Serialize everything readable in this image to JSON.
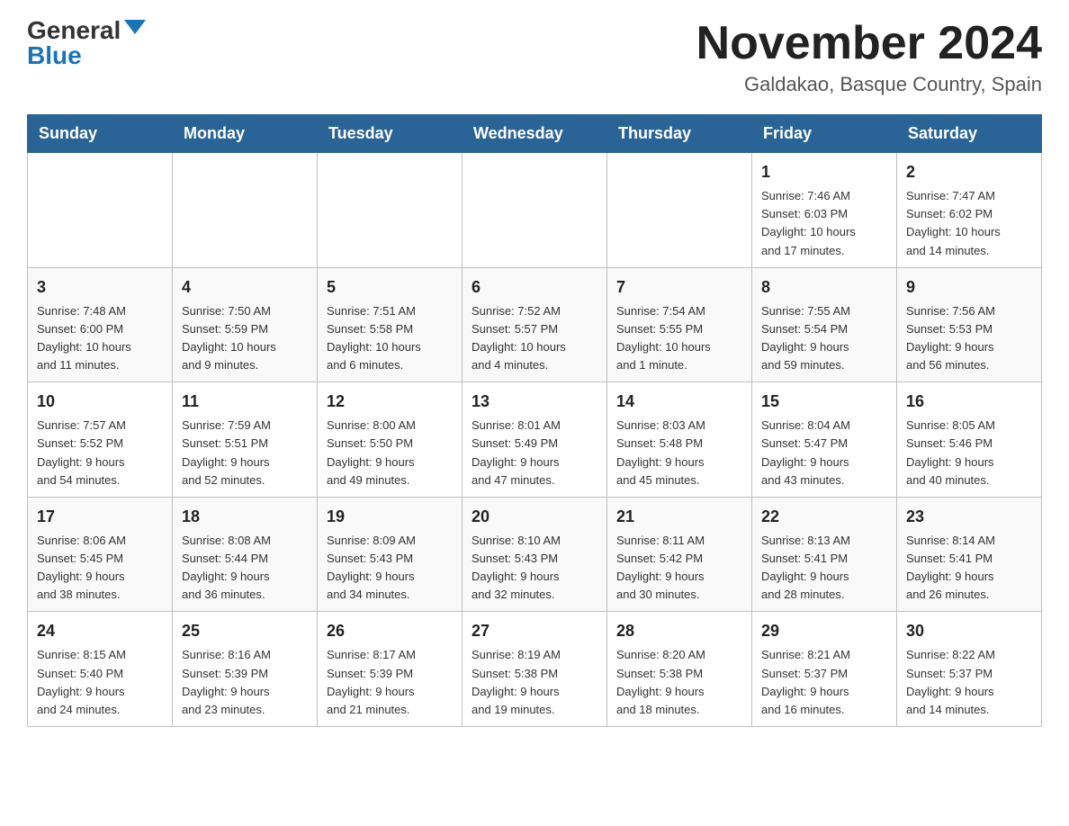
{
  "header": {
    "logo_general": "General",
    "logo_blue": "Blue",
    "month_title": "November 2024",
    "location": "Galdakao, Basque Country, Spain"
  },
  "weekdays": [
    "Sunday",
    "Monday",
    "Tuesday",
    "Wednesday",
    "Thursday",
    "Friday",
    "Saturday"
  ],
  "rows": [
    [
      {
        "day": "",
        "info": ""
      },
      {
        "day": "",
        "info": ""
      },
      {
        "day": "",
        "info": ""
      },
      {
        "day": "",
        "info": ""
      },
      {
        "day": "",
        "info": ""
      },
      {
        "day": "1",
        "info": "Sunrise: 7:46 AM\nSunset: 6:03 PM\nDaylight: 10 hours\nand 17 minutes."
      },
      {
        "day": "2",
        "info": "Sunrise: 7:47 AM\nSunset: 6:02 PM\nDaylight: 10 hours\nand 14 minutes."
      }
    ],
    [
      {
        "day": "3",
        "info": "Sunrise: 7:48 AM\nSunset: 6:00 PM\nDaylight: 10 hours\nand 11 minutes."
      },
      {
        "day": "4",
        "info": "Sunrise: 7:50 AM\nSunset: 5:59 PM\nDaylight: 10 hours\nand 9 minutes."
      },
      {
        "day": "5",
        "info": "Sunrise: 7:51 AM\nSunset: 5:58 PM\nDaylight: 10 hours\nand 6 minutes."
      },
      {
        "day": "6",
        "info": "Sunrise: 7:52 AM\nSunset: 5:57 PM\nDaylight: 10 hours\nand 4 minutes."
      },
      {
        "day": "7",
        "info": "Sunrise: 7:54 AM\nSunset: 5:55 PM\nDaylight: 10 hours\nand 1 minute."
      },
      {
        "day": "8",
        "info": "Sunrise: 7:55 AM\nSunset: 5:54 PM\nDaylight: 9 hours\nand 59 minutes."
      },
      {
        "day": "9",
        "info": "Sunrise: 7:56 AM\nSunset: 5:53 PM\nDaylight: 9 hours\nand 56 minutes."
      }
    ],
    [
      {
        "day": "10",
        "info": "Sunrise: 7:57 AM\nSunset: 5:52 PM\nDaylight: 9 hours\nand 54 minutes."
      },
      {
        "day": "11",
        "info": "Sunrise: 7:59 AM\nSunset: 5:51 PM\nDaylight: 9 hours\nand 52 minutes."
      },
      {
        "day": "12",
        "info": "Sunrise: 8:00 AM\nSunset: 5:50 PM\nDaylight: 9 hours\nand 49 minutes."
      },
      {
        "day": "13",
        "info": "Sunrise: 8:01 AM\nSunset: 5:49 PM\nDaylight: 9 hours\nand 47 minutes."
      },
      {
        "day": "14",
        "info": "Sunrise: 8:03 AM\nSunset: 5:48 PM\nDaylight: 9 hours\nand 45 minutes."
      },
      {
        "day": "15",
        "info": "Sunrise: 8:04 AM\nSunset: 5:47 PM\nDaylight: 9 hours\nand 43 minutes."
      },
      {
        "day": "16",
        "info": "Sunrise: 8:05 AM\nSunset: 5:46 PM\nDaylight: 9 hours\nand 40 minutes."
      }
    ],
    [
      {
        "day": "17",
        "info": "Sunrise: 8:06 AM\nSunset: 5:45 PM\nDaylight: 9 hours\nand 38 minutes."
      },
      {
        "day": "18",
        "info": "Sunrise: 8:08 AM\nSunset: 5:44 PM\nDaylight: 9 hours\nand 36 minutes."
      },
      {
        "day": "19",
        "info": "Sunrise: 8:09 AM\nSunset: 5:43 PM\nDaylight: 9 hours\nand 34 minutes."
      },
      {
        "day": "20",
        "info": "Sunrise: 8:10 AM\nSunset: 5:43 PM\nDaylight: 9 hours\nand 32 minutes."
      },
      {
        "day": "21",
        "info": "Sunrise: 8:11 AM\nSunset: 5:42 PM\nDaylight: 9 hours\nand 30 minutes."
      },
      {
        "day": "22",
        "info": "Sunrise: 8:13 AM\nSunset: 5:41 PM\nDaylight: 9 hours\nand 28 minutes."
      },
      {
        "day": "23",
        "info": "Sunrise: 8:14 AM\nSunset: 5:41 PM\nDaylight: 9 hours\nand 26 minutes."
      }
    ],
    [
      {
        "day": "24",
        "info": "Sunrise: 8:15 AM\nSunset: 5:40 PM\nDaylight: 9 hours\nand 24 minutes."
      },
      {
        "day": "25",
        "info": "Sunrise: 8:16 AM\nSunset: 5:39 PM\nDaylight: 9 hours\nand 23 minutes."
      },
      {
        "day": "26",
        "info": "Sunrise: 8:17 AM\nSunset: 5:39 PM\nDaylight: 9 hours\nand 21 minutes."
      },
      {
        "day": "27",
        "info": "Sunrise: 8:19 AM\nSunset: 5:38 PM\nDaylight: 9 hours\nand 19 minutes."
      },
      {
        "day": "28",
        "info": "Sunrise: 8:20 AM\nSunset: 5:38 PM\nDaylight: 9 hours\nand 18 minutes."
      },
      {
        "day": "29",
        "info": "Sunrise: 8:21 AM\nSunset: 5:37 PM\nDaylight: 9 hours\nand 16 minutes."
      },
      {
        "day": "30",
        "info": "Sunrise: 8:22 AM\nSunset: 5:37 PM\nDaylight: 9 hours\nand 14 minutes."
      }
    ]
  ]
}
